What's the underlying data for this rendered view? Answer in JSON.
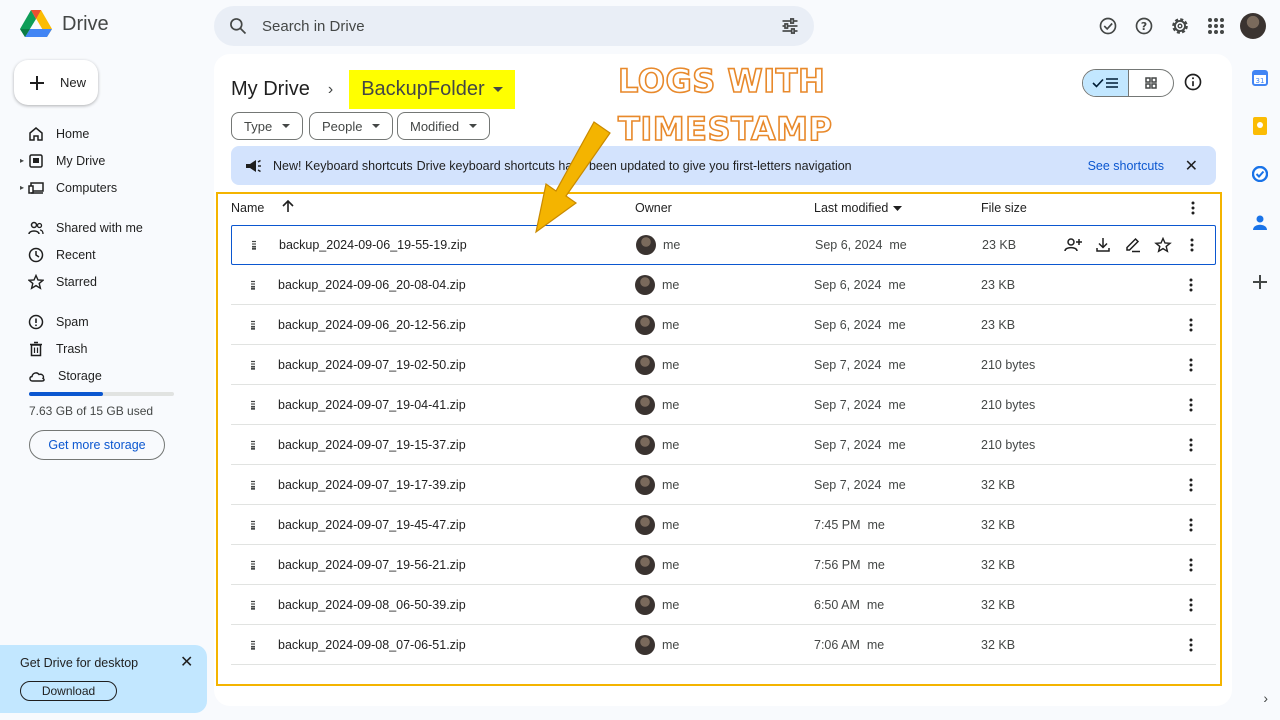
{
  "app": {
    "name": "Drive"
  },
  "search": {
    "placeholder": "Search in Drive"
  },
  "sidebar": {
    "new_label": "New",
    "items": [
      {
        "label": "Home",
        "icon": "home-icon"
      },
      {
        "label": "My Drive",
        "icon": "my-drive-icon"
      },
      {
        "label": "Computers",
        "icon": "computers-icon"
      },
      {
        "label": "Shared with me",
        "icon": "shared-icon"
      },
      {
        "label": "Recent",
        "icon": "clock-icon"
      },
      {
        "label": "Starred",
        "icon": "star-icon"
      },
      {
        "label": "Spam",
        "icon": "spam-icon"
      },
      {
        "label": "Trash",
        "icon": "trash-icon"
      },
      {
        "label": "Storage",
        "icon": "cloud-icon"
      }
    ],
    "storage_used_fraction": 0.509,
    "storage_text": "7.63 GB of 15 GB used",
    "get_more_storage": "Get more storage"
  },
  "promo": {
    "title": "Get Drive for desktop",
    "button": "Download"
  },
  "breadcrumb": {
    "root": "My Drive",
    "folder": "BackupFolder"
  },
  "filters": [
    "Type",
    "People",
    "Modified"
  ],
  "banner": {
    "title": "New! Keyboard shortcuts",
    "text": "Drive keyboard shortcuts have been updated to give you first-letters navigation",
    "link": "See shortcuts"
  },
  "table": {
    "headers": {
      "name": "Name",
      "owner": "Owner",
      "modified": "Last modified",
      "size": "File size"
    },
    "rows": [
      {
        "name": "backup_2024-09-06_19-55-19.zip",
        "owner": "me",
        "modified": "Sep 6, 2024",
        "modified_by": "me",
        "size": "23 KB"
      },
      {
        "name": "backup_2024-09-06_20-08-04.zip",
        "owner": "me",
        "modified": "Sep 6, 2024",
        "modified_by": "me",
        "size": "23 KB"
      },
      {
        "name": "backup_2024-09-06_20-12-56.zip",
        "owner": "me",
        "modified": "Sep 6, 2024",
        "modified_by": "me",
        "size": "23 KB"
      },
      {
        "name": "backup_2024-09-07_19-02-50.zip",
        "owner": "me",
        "modified": "Sep 7, 2024",
        "modified_by": "me",
        "size": "210 bytes"
      },
      {
        "name": "backup_2024-09-07_19-04-41.zip",
        "owner": "me",
        "modified": "Sep 7, 2024",
        "modified_by": "me",
        "size": "210 bytes"
      },
      {
        "name": "backup_2024-09-07_19-15-37.zip",
        "owner": "me",
        "modified": "Sep 7, 2024",
        "modified_by": "me",
        "size": "210 bytes"
      },
      {
        "name": "backup_2024-09-07_19-17-39.zip",
        "owner": "me",
        "modified": "Sep 7, 2024",
        "modified_by": "me",
        "size": "32 KB"
      },
      {
        "name": "backup_2024-09-07_19-45-47.zip",
        "owner": "me",
        "modified": "7:45 PM",
        "modified_by": "me",
        "size": "32 KB"
      },
      {
        "name": "backup_2024-09-07_19-56-21.zip",
        "owner": "me",
        "modified": "7:56 PM",
        "modified_by": "me",
        "size": "32 KB"
      },
      {
        "name": "backup_2024-09-08_06-50-39.zip",
        "owner": "me",
        "modified": "6:50 AM",
        "modified_by": "me",
        "size": "32 KB"
      },
      {
        "name": "backup_2024-09-08_07-06-51.zip",
        "owner": "me",
        "modified": "7:06 AM",
        "modified_by": "me",
        "size": "32 KB"
      }
    ]
  },
  "annotation": {
    "line1": "LOGS WITH",
    "line2": "TIMESTAMP"
  },
  "colors": {
    "accent": "#0b57d0",
    "highlight": "#ffff00",
    "frame": "#f4b400",
    "annotation": "#e8892b",
    "arrow": "#f4b400"
  }
}
